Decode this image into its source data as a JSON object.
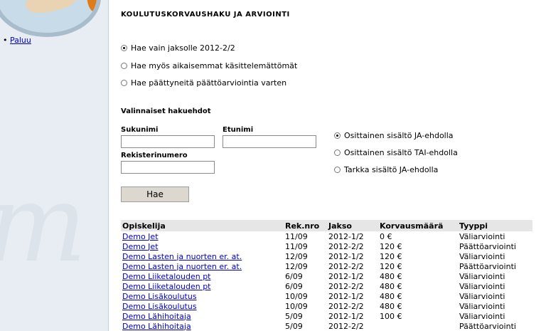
{
  "sidebar": {
    "back_label": "Paluu"
  },
  "page": {
    "title": "KOULUTUSKORVAUSHAKU JA ARVIOINTI"
  },
  "search_mode": {
    "options": [
      {
        "label": "Hae vain jaksolle 2012-2/2",
        "selected": true
      },
      {
        "label": "Hae myös aikaisemmat käsittelemättömät",
        "selected": false
      },
      {
        "label": "Hae päättyneitä päättöarviointia varten",
        "selected": false
      }
    ]
  },
  "filters": {
    "heading": "Valinnaiset hakuehdot",
    "lastname_label": "Sukunimi",
    "lastname_value": "",
    "firstname_label": "Etunimi",
    "firstname_value": "",
    "regnum_label": "Rekisterinumero",
    "regnum_value": "",
    "match_options": [
      {
        "label": "Osittainen sisältö JA-ehdolla",
        "selected": true
      },
      {
        "label": "Osittainen sisältö TAI-ehdolla",
        "selected": false
      },
      {
        "label": "Tarkka sisältö JA-ehdolla",
        "selected": false
      }
    ],
    "search_button": "Hae"
  },
  "results": {
    "headers": [
      "Opiskelija",
      "Rek.nro",
      "Jakso",
      "Korvausmäärä",
      "Tyyppi"
    ],
    "rows": [
      [
        "Demo Jet",
        "11/09",
        "2012-1/2",
        "0 €",
        "Väliarviointi"
      ],
      [
        "Demo Jet",
        "11/09",
        "2012-2/2",
        "120 €",
        "Päättöarviointi"
      ],
      [
        "Demo Lasten ja nuorten er. at.",
        "12/09",
        "2012-1/2",
        "120 €",
        "Väliarviointi"
      ],
      [
        "Demo Lasten ja nuorten er. at.",
        "12/09",
        "2012-2/2",
        "120 €",
        "Päättöarviointi"
      ],
      [
        "Demo Liiketalouden pt",
        "6/09",
        "2012-1/2",
        "480 €",
        "Väliarviointi"
      ],
      [
        "Demo Liiketalouden pt",
        "6/09",
        "2012-2/2",
        "480 €",
        "Väliarviointi"
      ],
      [
        "Demo Lisäkoulutus",
        "10/09",
        "2012-1/2",
        "480 €",
        "Väliarviointi"
      ],
      [
        "Demo Lisäkoulutus",
        "10/09",
        "2012-2/2",
        "480 €",
        "Väliarviointi"
      ],
      [
        "Demo Lähihoitaja",
        "5/09",
        "2012-1/2",
        "100 €",
        "Väliarviointi"
      ],
      [
        "Demo Lähihoitaja",
        "5/09",
        "2012-2/2",
        "",
        "Päättöarviointi"
      ]
    ]
  }
}
